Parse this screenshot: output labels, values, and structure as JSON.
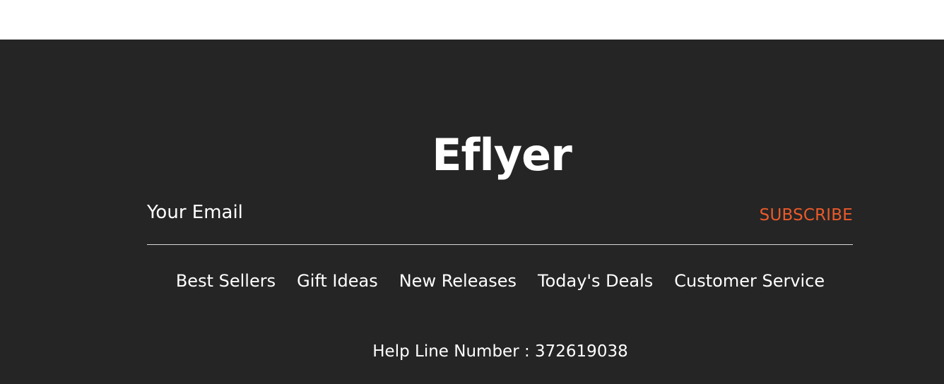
{
  "footer": {
    "logo_text": "Eflyer",
    "newsletter": {
      "email_placeholder": "Your Email",
      "subscribe_label": "SUBSCRIBE"
    },
    "nav_links": [
      "Best Sellers",
      "Gift Ideas",
      "New Releases",
      "Today's Deals",
      "Customer Service"
    ],
    "helpline_text": "Help Line Number : 372619038"
  },
  "colors": {
    "footer_background": "#252525",
    "accent": "#ea5a2a",
    "text": "#ffffff"
  }
}
